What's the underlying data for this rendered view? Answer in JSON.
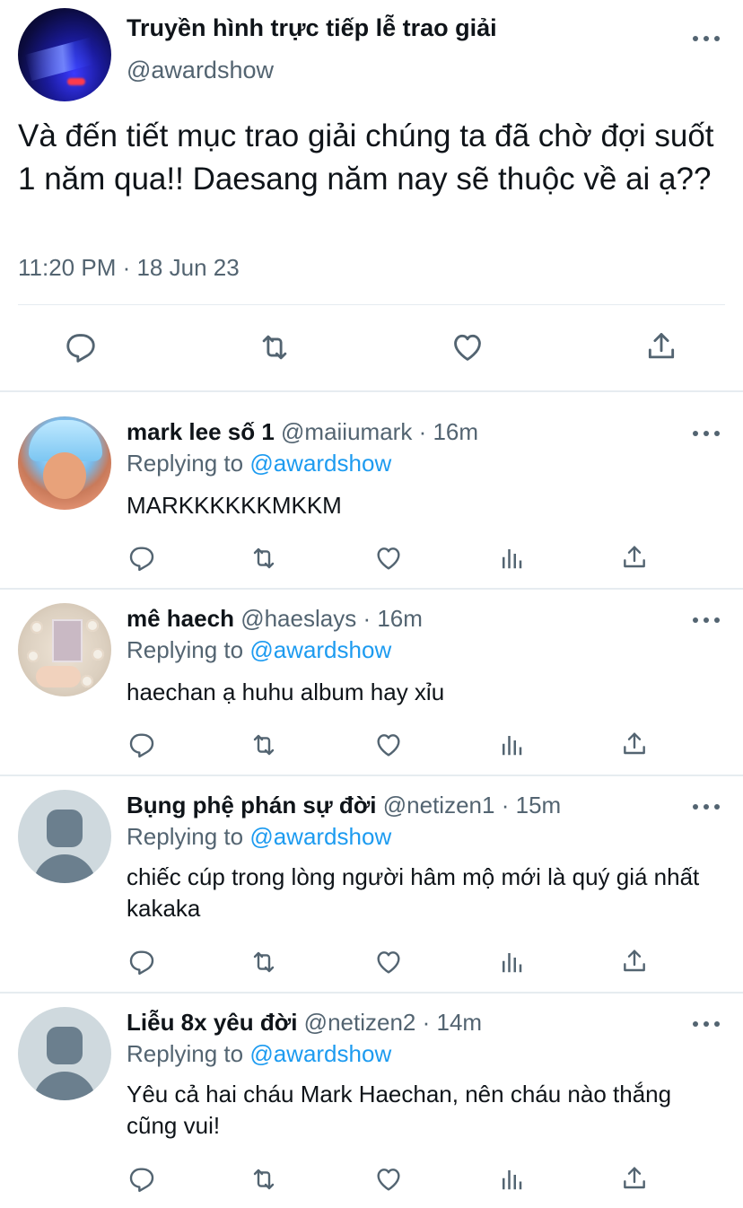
{
  "main_tweet": {
    "display_name": "Truyền hình trực tiếp lễ trao giải",
    "handle": "@awardshow",
    "text": "Và đến tiết mục trao giải chúng ta đã chờ đợi suốt 1 năm qua!! Daesang năm nay sẽ thuộc về ai ạ??",
    "timestamp": "11:20 PM · 18 Jun 23",
    "actions": [
      "reply-icon",
      "retweet-icon",
      "like-icon",
      "share-icon"
    ]
  },
  "replies": [
    {
      "display_name": "mark lee số 1",
      "handle": "@maiiumark",
      "time": "16m",
      "replying_prefix": "Replying to",
      "replying_to": "@awardshow",
      "text": "MARKKKKKKMKKM",
      "actions": [
        "reply-icon",
        "retweet-icon",
        "like-icon",
        "analytics-icon",
        "share-icon"
      ]
    },
    {
      "display_name": "mê haech",
      "handle": "@haeslays",
      "time": "16m",
      "replying_prefix": "Replying to",
      "replying_to": "@awardshow",
      "text": "haechan ạ huhu album hay xỉu",
      "actions": [
        "reply-icon",
        "retweet-icon",
        "like-icon",
        "analytics-icon",
        "share-icon"
      ]
    },
    {
      "display_name": "Bụng phệ phán sự đời",
      "handle": "@netizen1",
      "time": "15m",
      "replying_prefix": "Replying to",
      "replying_to": "@awardshow",
      "text": "chiếc cúp trong lòng người hâm mộ mới là quý giá nhất kakaka",
      "actions": [
        "reply-icon",
        "retweet-icon",
        "like-icon",
        "analytics-icon",
        "share-icon"
      ]
    },
    {
      "display_name": "Liễu 8x yêu đời",
      "handle": "@netizen2",
      "time": "14m",
      "replying_prefix": "Replying to",
      "replying_to": "@awardshow",
      "text": "Yêu cả hai cháu Mark Haechan, nên cháu nào thắng cũng vui!",
      "actions": [
        "reply-icon",
        "retweet-icon",
        "like-icon",
        "analytics-icon",
        "share-icon"
      ]
    }
  ],
  "separator": "·",
  "colors": {
    "text": "#0f1419",
    "secondary": "#536471",
    "link": "#1d9bf0",
    "divider": "#e6ecf0"
  }
}
